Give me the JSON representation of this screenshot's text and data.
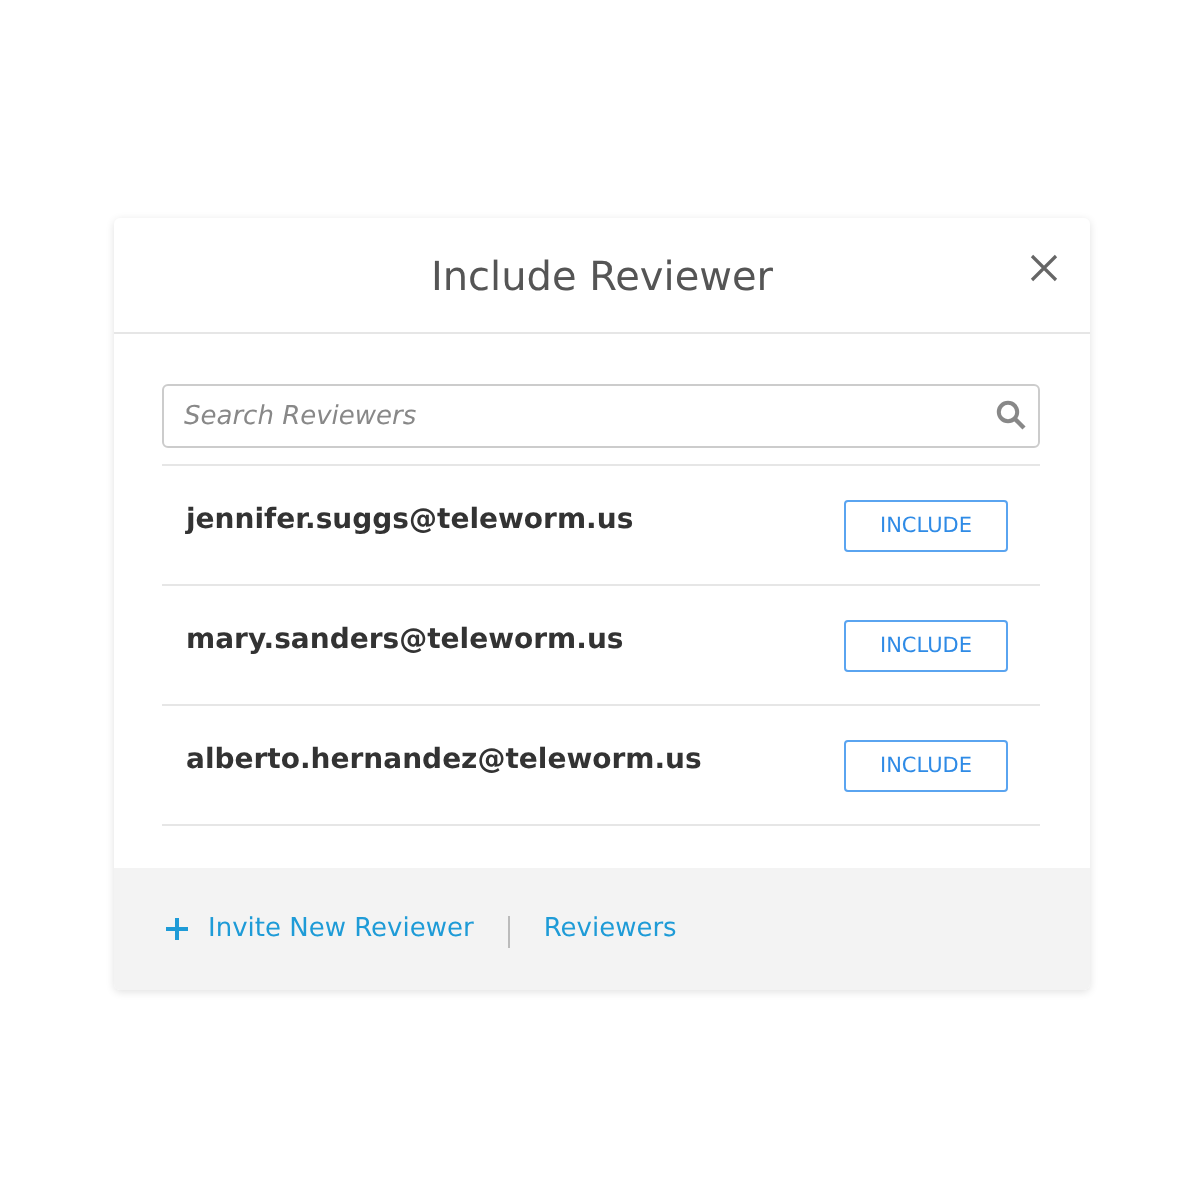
{
  "dialog": {
    "title": "Include Reviewer"
  },
  "search": {
    "placeholder": "Search Reviewers"
  },
  "reviewers": [
    {
      "email": "jennifer.suggs@teleworm.us",
      "action": "INCLUDE"
    },
    {
      "email": "mary.sanders@teleworm.us",
      "action": "INCLUDE"
    },
    {
      "email": "alberto.hernandez@teleworm.us",
      "action": "INCLUDE"
    }
  ],
  "footer": {
    "links": [
      "Invite New Reviewer",
      "Reviewers"
    ]
  }
}
